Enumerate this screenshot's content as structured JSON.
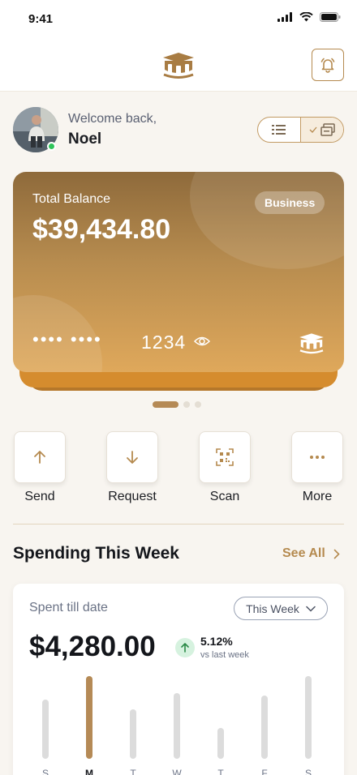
{
  "status_bar": {
    "time": "9:41"
  },
  "header": {
    "logo_icon": "graduation-cap-logo",
    "bell_icon": "bell-icon"
  },
  "user": {
    "greeting": "Welcome back,",
    "name": "Noel",
    "online": true
  },
  "view_toggle": {
    "left_icon": "list-icon",
    "right_icon": "card-stack-icon",
    "selected": "right"
  },
  "card": {
    "label": "Total Balance",
    "balance": "$39,434.80",
    "badge": "Business",
    "masked_number": "•••• ••••",
    "last4": "1234",
    "reveal_icon": "eye-icon",
    "brand_icon": "graduation-cap-logo",
    "pager": {
      "total": 3,
      "active": 1
    }
  },
  "quick_actions": [
    {
      "label": "Send",
      "icon": "arrow-up-icon"
    },
    {
      "label": "Request",
      "icon": "arrow-down-icon"
    },
    {
      "label": "Scan",
      "icon": "qr-scan-icon"
    },
    {
      "label": "More",
      "icon": "more-dots-icon"
    }
  ],
  "spending": {
    "title": "Spending This Week",
    "see_all": "See All",
    "spent_label": "Spent till date",
    "period": "This Week",
    "amount": "$4,280.00",
    "change_pct": "5.12%",
    "change_note": "vs last week",
    "trend": "up"
  },
  "colors": {
    "accent": "#b58a4f",
    "card_top": "#8e6a3b",
    "card_bottom": "#dfa85b",
    "trend_up": "#2fc45a"
  },
  "chart_data": {
    "type": "bar",
    "categories": [
      "S",
      "M",
      "T",
      "W",
      "T",
      "F",
      "S"
    ],
    "values": [
      0.72,
      1.0,
      0.6,
      0.79,
      0.37,
      0.76,
      1.0
    ],
    "highlighted": "M"
  }
}
